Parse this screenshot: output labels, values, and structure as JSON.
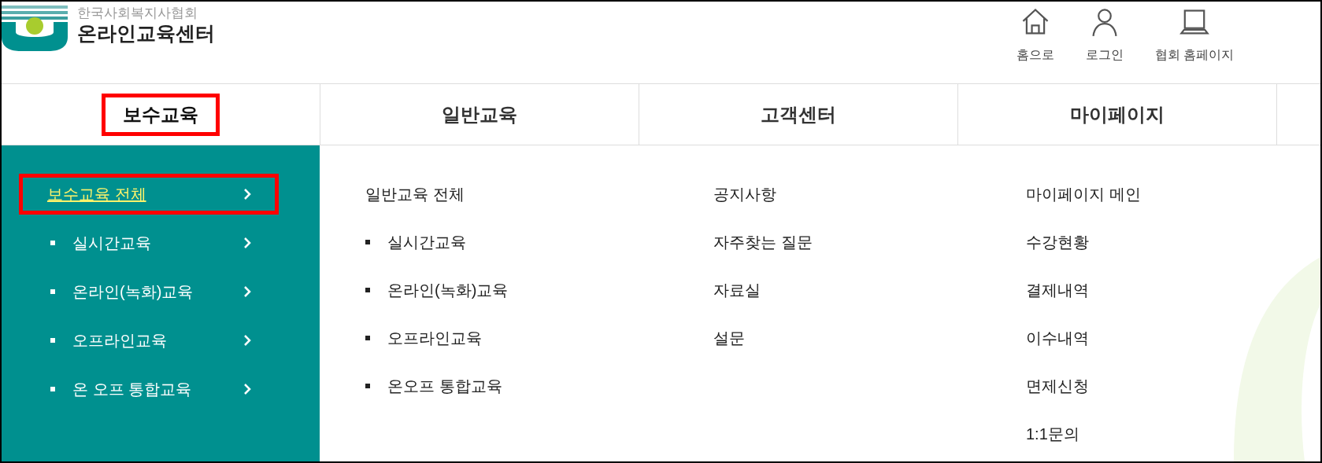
{
  "logo": {
    "org": "한국사회복지사협회",
    "title": "온라인교육센터"
  },
  "utility_links": [
    {
      "label": "홈으로"
    },
    {
      "label": "로그인"
    },
    {
      "label": "협회 홈페이지"
    }
  ],
  "nav_tabs": [
    {
      "label": "보수교육",
      "selected": true,
      "highlighted": true
    },
    {
      "label": "일반교육",
      "selected": false,
      "highlighted": false
    },
    {
      "label": "고객센터",
      "selected": false,
      "highlighted": false
    },
    {
      "label": "마이페이지",
      "selected": false,
      "highlighted": false
    }
  ],
  "sidebar_menu": [
    {
      "label": "보수교육 전체",
      "kind": "plain",
      "selected": true,
      "highlighted": true
    },
    {
      "label": "실시간교육",
      "kind": "bullet",
      "selected": false,
      "highlighted": false
    },
    {
      "label": "온라인(녹화)교육",
      "kind": "bullet",
      "selected": false,
      "highlighted": false
    },
    {
      "label": "오프라인교육",
      "kind": "bullet",
      "selected": false,
      "highlighted": false
    },
    {
      "label": "온 오프 통합교육",
      "kind": "bullet",
      "selected": false,
      "highlighted": false
    }
  ],
  "submenu_columns": [
    {
      "items": [
        {
          "label": "일반교육 전체",
          "kind": "plain"
        },
        {
          "label": "실시간교육",
          "kind": "bullet"
        },
        {
          "label": "온라인(녹화)교육",
          "kind": "bullet"
        },
        {
          "label": "오프라인교육",
          "kind": "bullet"
        },
        {
          "label": "온오프 통합교육",
          "kind": "bullet"
        }
      ]
    },
    {
      "items": [
        {
          "label": "공지사항",
          "kind": "plain"
        },
        {
          "label": "자주찾는 질문",
          "kind": "plain"
        },
        {
          "label": "자료실",
          "kind": "plain"
        },
        {
          "label": "설문",
          "kind": "plain"
        }
      ]
    },
    {
      "items": [
        {
          "label": "마이페이지 메인",
          "kind": "plain"
        },
        {
          "label": "수강현황",
          "kind": "plain"
        },
        {
          "label": "결제내역",
          "kind": "plain"
        },
        {
          "label": "이수내역",
          "kind": "plain"
        },
        {
          "label": "면제신청",
          "kind": "plain"
        },
        {
          "label": "1:1문의",
          "kind": "plain"
        }
      ]
    }
  ]
}
